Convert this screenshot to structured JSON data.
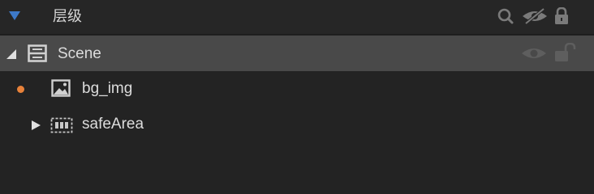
{
  "panel": {
    "title": "层级",
    "header_icons": [
      "collapse-triangle-icon",
      "search-icon",
      "eye-off-icon",
      "lock-icon"
    ],
    "accent_color": "#3d79c8"
  },
  "tree": [
    {
      "label": "Scene",
      "type": "scene-node-icon",
      "expanded": true,
      "selected": true,
      "row_icons": [
        "eye-icon",
        "unlock-icon"
      ]
    },
    {
      "label": "bg_img",
      "type": "image-icon",
      "modified_dot_color": "#e8823a"
    },
    {
      "label": "safeArea",
      "type": "safe-area-icon",
      "expanded": false
    }
  ]
}
